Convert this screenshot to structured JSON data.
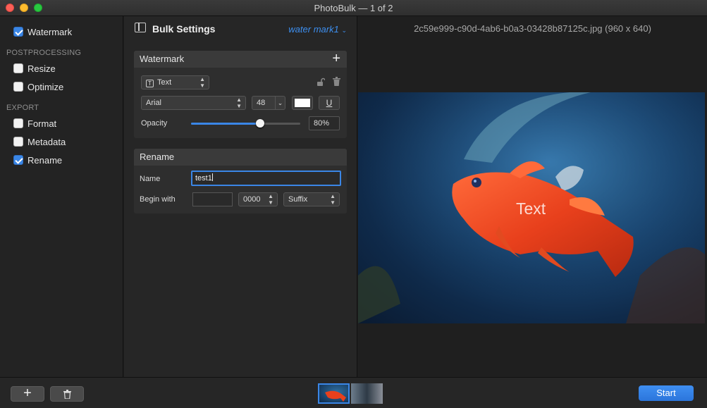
{
  "window": {
    "title": "PhotoBulk — 1 of 2"
  },
  "sidebar": {
    "items": [
      {
        "label": "Watermark",
        "checked": true
      },
      {
        "section": "POSTPROCESSING"
      },
      {
        "label": "Resize",
        "checked": false
      },
      {
        "label": "Optimize",
        "checked": false
      },
      {
        "section": "EXPORT"
      },
      {
        "label": "Format",
        "checked": false
      },
      {
        "label": "Metadata",
        "checked": false
      },
      {
        "label": "Rename",
        "checked": true
      }
    ]
  },
  "settings": {
    "title": "Bulk Settings",
    "preset": "water mark1",
    "watermark": {
      "header": "Watermark",
      "type": "Text",
      "font": "Arial",
      "size": "48",
      "opacity_label": "Opacity",
      "opacity_value": "80%",
      "opacity_fraction": 0.8
    },
    "rename": {
      "header": "Rename",
      "name_label": "Name",
      "name_value": "test1",
      "begin_label": "Begin with",
      "begin_value": "",
      "counter": "0000",
      "position": "Suffix"
    }
  },
  "preview": {
    "file_label": "2c59e999-c90d-4ab6-b0a3-03428b87125c.jpg (960 x 640)",
    "watermark_text": "Text"
  },
  "footer": {
    "start_label": "Start"
  },
  "colors": {
    "accent": "#3a86e6",
    "link": "#3d8ff0",
    "close": "#fc5f57",
    "minimize": "#fdbc2e",
    "maximize": "#28c840"
  }
}
